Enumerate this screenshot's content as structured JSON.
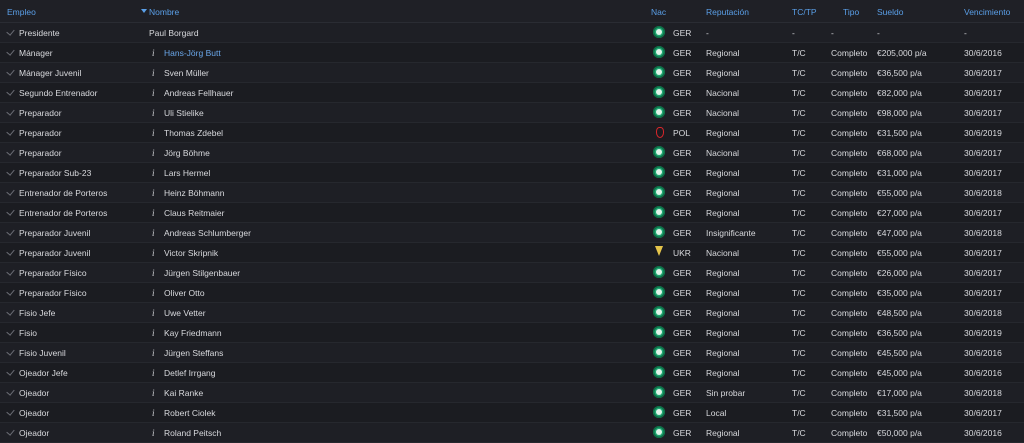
{
  "columns": {
    "empleo": "Empleo",
    "nombre": "Nombre",
    "nac": "Nac",
    "reputacion": "Reputación",
    "tctp": "TC/TP",
    "tipo": "Tipo",
    "sueldo": "Sueldo",
    "vencimiento": "Vencimiento"
  },
  "colors": {
    "accent": "#5a9fe8",
    "background": "#1c1d22"
  },
  "rows": [
    {
      "empleo": "Presidente",
      "info": "",
      "nombre": "Paul Borgard",
      "nac": "GER",
      "flag": "ger-flag-icon",
      "reputacion": "-",
      "tctp": "-",
      "tipo": "-",
      "sueldo": "-",
      "vencimiento": "-"
    },
    {
      "empleo": "Mánager",
      "info": "i",
      "nombre": "Hans-Jörg Butt",
      "nac": "GER",
      "flag": "ger-flag-icon",
      "reputacion": "Regional",
      "tctp": "T/C",
      "tipo": "Completo",
      "sueldo": "€205,000 p/a",
      "vencimiento": "30/6/2016"
    },
    {
      "empleo": "Mánager Juvenil",
      "info": "i",
      "nombre": "Sven Müller",
      "nac": "GER",
      "flag": "ger-flag-icon",
      "reputacion": "Regional",
      "tctp": "T/C",
      "tipo": "Completo",
      "sueldo": "€36,500 p/a",
      "vencimiento": "30/6/2017"
    },
    {
      "empleo": "Segundo Entrenador",
      "info": "i",
      "nombre": "Andreas Fellhauer",
      "nac": "GER",
      "flag": "ger-flag-icon",
      "reputacion": "Nacional",
      "tctp": "T/C",
      "tipo": "Completo",
      "sueldo": "€82,000 p/a",
      "vencimiento": "30/6/2017"
    },
    {
      "empleo": "Preparador",
      "info": "i",
      "nombre": "Uli Stielike",
      "nac": "GER",
      "flag": "ger-flag-icon",
      "reputacion": "Nacional",
      "tctp": "T/C",
      "tipo": "Completo",
      "sueldo": "€98,000 p/a",
      "vencimiento": "30/6/2017"
    },
    {
      "empleo": "Preparador",
      "info": "i",
      "nombre": "Thomas Zdebel",
      "nac": "POL",
      "flag": "pol-flag-icon",
      "reputacion": "Regional",
      "tctp": "T/C",
      "tipo": "Completo",
      "sueldo": "€31,500 p/a",
      "vencimiento": "30/6/2019"
    },
    {
      "empleo": "Preparador",
      "info": "i",
      "nombre": "Jörg Böhme",
      "nac": "GER",
      "flag": "ger-flag-icon",
      "reputacion": "Nacional",
      "tctp": "T/C",
      "tipo": "Completo",
      "sueldo": "€68,000 p/a",
      "vencimiento": "30/6/2017"
    },
    {
      "empleo": "Preparador Sub-23",
      "info": "i",
      "nombre": "Lars Hermel",
      "nac": "GER",
      "flag": "ger-flag-icon",
      "reputacion": "Regional",
      "tctp": "T/C",
      "tipo": "Completo",
      "sueldo": "€31,000 p/a",
      "vencimiento": "30/6/2017"
    },
    {
      "empleo": "Entrenador de Porteros",
      "info": "i",
      "nombre": "Heinz Böhmann",
      "nac": "GER",
      "flag": "ger-flag-icon",
      "reputacion": "Regional",
      "tctp": "T/C",
      "tipo": "Completo",
      "sueldo": "€55,000 p/a",
      "vencimiento": "30/6/2018"
    },
    {
      "empleo": "Entrenador de Porteros",
      "info": "i",
      "nombre": "Claus Reitmaier",
      "nac": "GER",
      "flag": "ger-flag-icon",
      "reputacion": "Regional",
      "tctp": "T/C",
      "tipo": "Completo",
      "sueldo": "€27,000 p/a",
      "vencimiento": "30/6/2017"
    },
    {
      "empleo": "Preparador Juvenil",
      "info": "i",
      "nombre": "Andreas Schlumberger",
      "nac": "GER",
      "flag": "ger-flag-icon",
      "reputacion": "Insignificante",
      "tctp": "T/C",
      "tipo": "Completo",
      "sueldo": "€47,000 p/a",
      "vencimiento": "30/6/2018"
    },
    {
      "empleo": "Preparador Juvenil",
      "info": "i",
      "nombre": "Victor Skripnik",
      "nac": "UKR",
      "flag": "ukr-flag-icon",
      "reputacion": "Nacional",
      "tctp": "T/C",
      "tipo": "Completo",
      "sueldo": "€55,000 p/a",
      "vencimiento": "30/6/2017"
    },
    {
      "empleo": "Preparador Físico",
      "info": "i",
      "nombre": "Jürgen Stilgenbauer",
      "nac": "GER",
      "flag": "ger-flag-icon",
      "reputacion": "Regional",
      "tctp": "T/C",
      "tipo": "Completo",
      "sueldo": "€26,000 p/a",
      "vencimiento": "30/6/2017"
    },
    {
      "empleo": "Preparador Físico",
      "info": "i",
      "nombre": "Oliver Otto",
      "nac": "GER",
      "flag": "ger-flag-icon",
      "reputacion": "Regional",
      "tctp": "T/C",
      "tipo": "Completo",
      "sueldo": "€35,000 p/a",
      "vencimiento": "30/6/2017"
    },
    {
      "empleo": "Fisio Jefe",
      "info": "i",
      "nombre": "Uwe Vetter",
      "nac": "GER",
      "flag": "ger-flag-icon",
      "reputacion": "Regional",
      "tctp": "T/C",
      "tipo": "Completo",
      "sueldo": "€48,500 p/a",
      "vencimiento": "30/6/2018"
    },
    {
      "empleo": "Fisio",
      "info": "i",
      "nombre": "Kay Friedmann",
      "nac": "GER",
      "flag": "ger-flag-icon",
      "reputacion": "Regional",
      "tctp": "T/C",
      "tipo": "Completo",
      "sueldo": "€36,500 p/a",
      "vencimiento": "30/6/2019"
    },
    {
      "empleo": "Fisio Juvenil",
      "info": "i",
      "nombre": "Jürgen Steffans",
      "nac": "GER",
      "flag": "ger-flag-icon",
      "reputacion": "Regional",
      "tctp": "T/C",
      "tipo": "Completo",
      "sueldo": "€45,500 p/a",
      "vencimiento": "30/6/2016"
    },
    {
      "empleo": "Ojeador Jefe",
      "info": "i",
      "nombre": "Detlef Irrgang",
      "nac": "GER",
      "flag": "ger-flag-icon",
      "reputacion": "Regional",
      "tctp": "T/C",
      "tipo": "Completo",
      "sueldo": "€45,000 p/a",
      "vencimiento": "30/6/2016"
    },
    {
      "empleo": "Ojeador",
      "info": "i",
      "nombre": "Kai Ranke",
      "nac": "GER",
      "flag": "ger-flag-icon",
      "reputacion": "Sin probar",
      "tctp": "T/C",
      "tipo": "Completo",
      "sueldo": "€17,000 p/a",
      "vencimiento": "30/6/2018"
    },
    {
      "empleo": "Ojeador",
      "info": "i",
      "nombre": "Robert Ciolek",
      "nac": "GER",
      "flag": "ger-flag-icon",
      "reputacion": "Local",
      "tctp": "T/C",
      "tipo": "Completo",
      "sueldo": "€31,500 p/a",
      "vencimiento": "30/6/2017"
    },
    {
      "empleo": "Ojeador",
      "info": "i",
      "nombre": "Roland Peitsch",
      "nac": "GER",
      "flag": "ger-flag-icon",
      "reputacion": "Regional",
      "tctp": "T/C",
      "tipo": "Completo",
      "sueldo": "€50,000 p/a",
      "vencimiento": "30/6/2016"
    }
  ]
}
